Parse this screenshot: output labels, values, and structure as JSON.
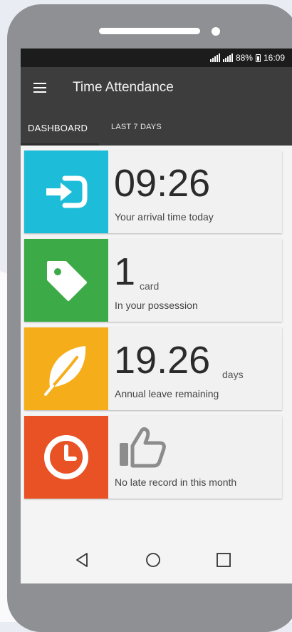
{
  "status_bar": {
    "battery": "88%",
    "time": "16:09"
  },
  "app_bar": {
    "title": "Time Attendance",
    "menu_icon": "hamburger-menu-icon"
  },
  "tabs": [
    {
      "label": "DASHBOARD",
      "active": true
    },
    {
      "label": "LAST 7 DAYS",
      "active": false
    }
  ],
  "cards": [
    {
      "icon": "login-arrow-icon",
      "color": "#1dbcd8",
      "value": "09:26",
      "unit": "",
      "caption": "Your arrival time today"
    },
    {
      "icon": "tag-icon",
      "color": "#3daa48",
      "value": "1",
      "unit": "card",
      "caption": "In your possession"
    },
    {
      "icon": "leaf-icon",
      "color": "#f6ad1a",
      "value": "19.26",
      "unit": "days",
      "caption": "Annual leave remaining"
    },
    {
      "icon": "clock-icon",
      "color": "#e85225",
      "value": "",
      "unit": "",
      "caption": "No late record in this month",
      "badge_icon": "thumbs-up-icon"
    }
  ],
  "nav_bar": [
    "back-icon",
    "home-icon",
    "recents-icon"
  ]
}
